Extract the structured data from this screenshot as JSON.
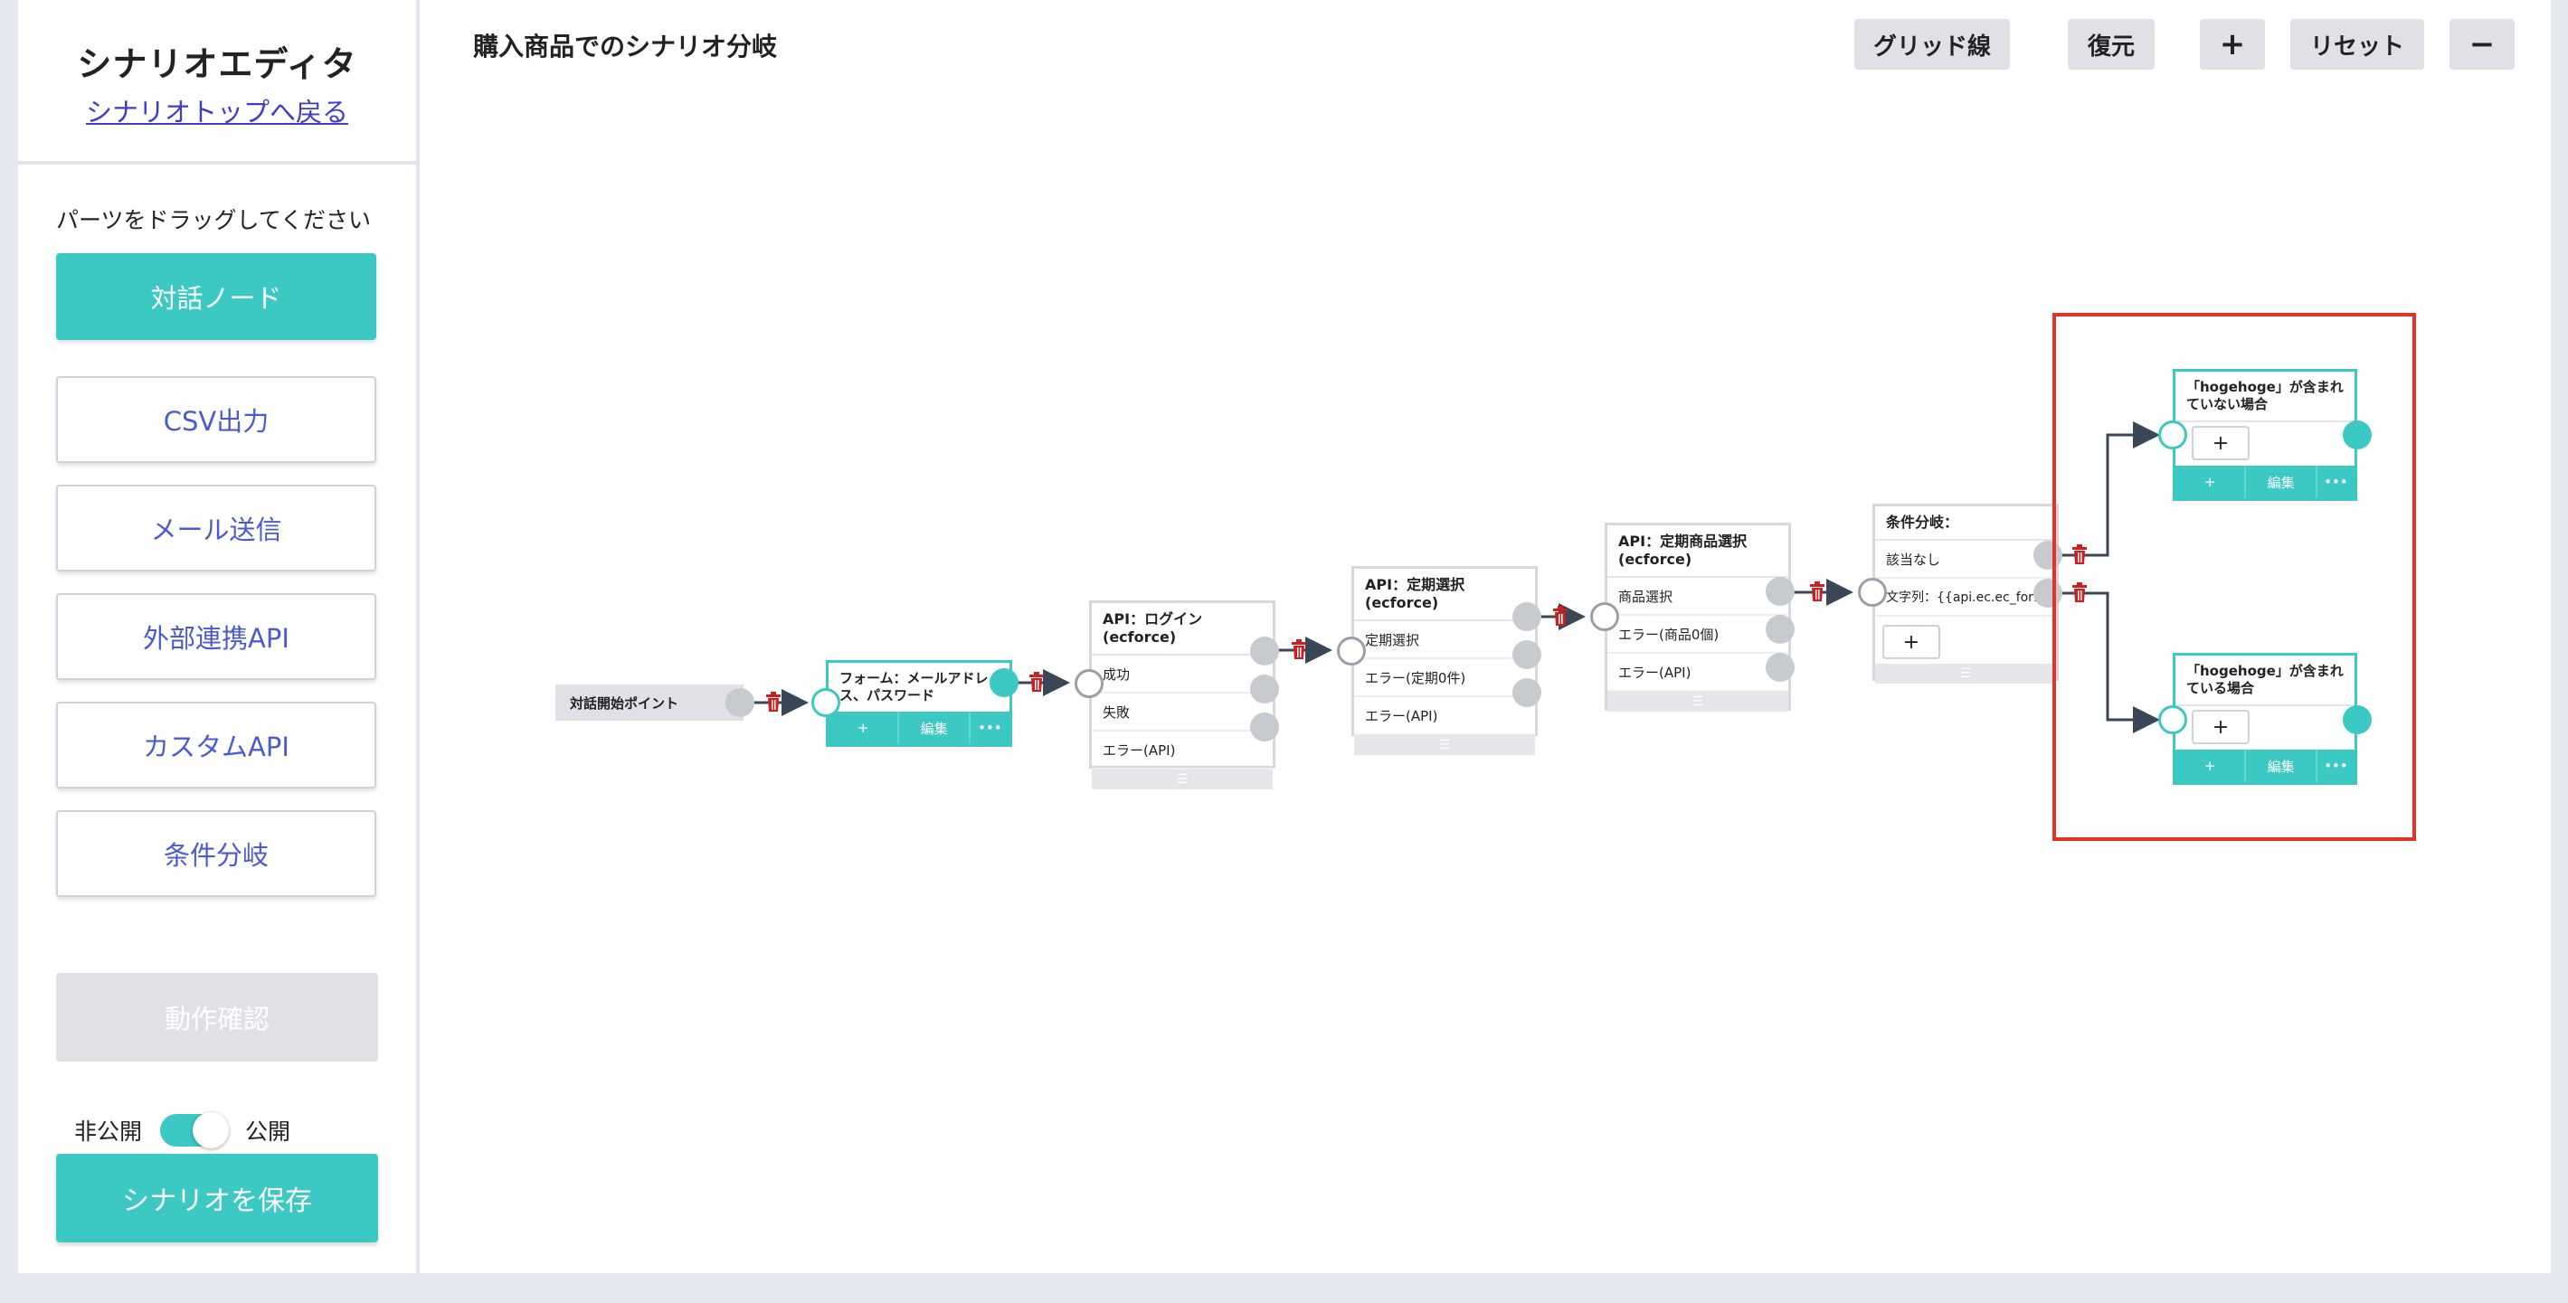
{
  "sidebar": {
    "title": "シナリオエディタ",
    "back_link": "シナリオトップへ戻る",
    "drag_hint": "パーツをドラッグしてください",
    "parts": [
      "対話ノード",
      "CSV出力",
      "メール送信",
      "外部連携API",
      "カスタムAPI",
      "条件分岐"
    ],
    "check_button": "動作確認",
    "private_label": "非公開",
    "public_label": "公開",
    "publish_state": "公開",
    "save_button": "シナリオを保存"
  },
  "canvas": {
    "title": "購入商品でのシナリオ分岐",
    "toolbar": {
      "grid": "グリッド線",
      "restore": "復元",
      "zoom_in": "+",
      "reset": "リセット",
      "zoom_out": "−"
    }
  },
  "nodes": {
    "start": "対話開始ポイント",
    "form": {
      "title": "フォーム：メールアドレス、パスワード",
      "add": "+",
      "edit": "編集",
      "more": "•••"
    },
    "login": {
      "title": "API：ログイン(ecforce)",
      "rows": [
        "成功",
        "失敗",
        "エラー(API)"
      ]
    },
    "subscription": {
      "title": "API：定期選択(ecforce)",
      "rows": [
        "定期選択",
        "エラー(定期0件)",
        "エラー(API)"
      ]
    },
    "product": {
      "title": "API：定期商品選択(ecforce)",
      "rows": [
        "商品選択",
        "エラー(商品0個)",
        "エラー(API)"
      ]
    },
    "condition": {
      "title": "条件分岐：",
      "rows": [
        "該当なし",
        "文字列：{{api.ec.ec_for…"
      ],
      "add": "+"
    },
    "not_contains": {
      "title": "「hogehoge」が含まれていない場合",
      "add": "+",
      "edit": "編集",
      "more": "•••"
    },
    "contains": {
      "title": "「hogehoge」が含まれている場合",
      "add": "+",
      "edit": "編集",
      "more": "•••"
    }
  },
  "colors": {
    "accent": "#3cc8c3",
    "link": "#3f3cc8",
    "highlight": "#e43524",
    "trash": "#cc1f1f"
  }
}
